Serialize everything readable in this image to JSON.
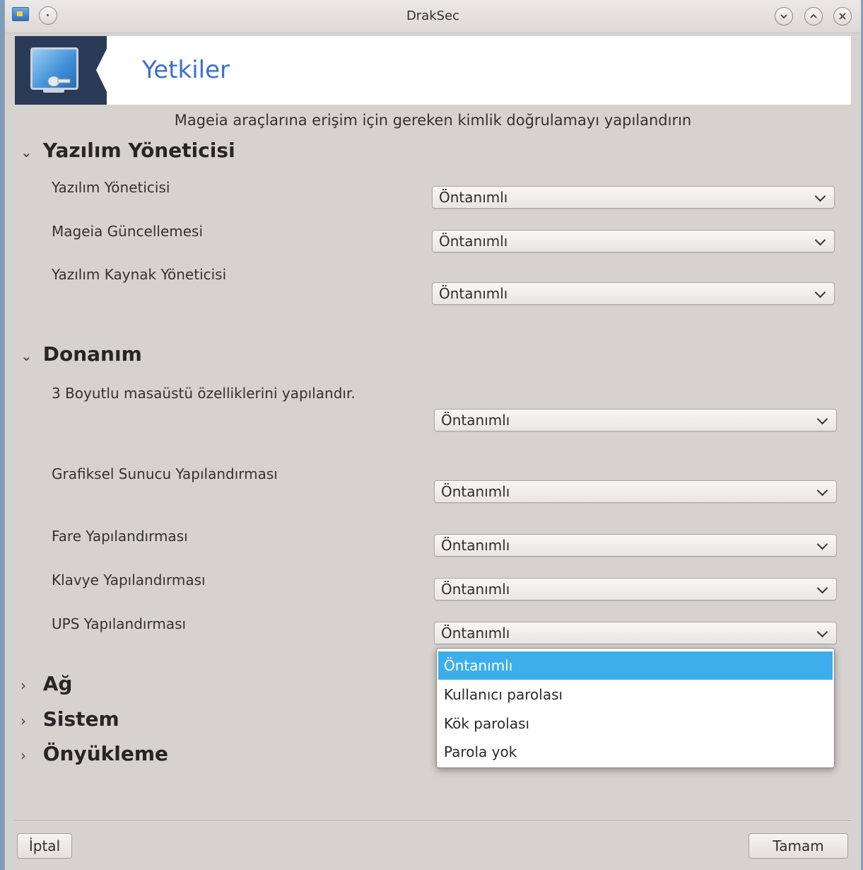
{
  "window": {
    "title": "DrakSec"
  },
  "header": {
    "title": "Yetkiler"
  },
  "subtitle": "Mageia araçlarına erişim için gereken kimlik doğrulamayı yapılandırın",
  "sections": {
    "software": {
      "title": "Yazılım Yöneticisi",
      "expanded": true
    },
    "hardware": {
      "title": "Donanım",
      "expanded": true
    },
    "network": {
      "title": "Ağ",
      "expanded": false
    },
    "system": {
      "title": "Sistem",
      "expanded": false
    },
    "boot": {
      "title": "Önyükleme",
      "expanded": false
    }
  },
  "software_rows": [
    {
      "label": "Yazılım Yöneticisi",
      "value": "Öntanımlı"
    },
    {
      "label": "Mageia Güncellemesi",
      "value": "Öntanımlı"
    },
    {
      "label": "Yazılım Kaynak Yöneticisi",
      "value": "Öntanımlı"
    }
  ],
  "hardware_rows": [
    {
      "label": "3 Boyutlu masaüstü özelliklerini yapılandır.",
      "value": "Öntanımlı"
    },
    {
      "label": "Grafiksel Sunucu Yapılandırması",
      "value": "Öntanımlı"
    },
    {
      "label": "Fare Yapılandırması",
      "value": "Öntanımlı"
    },
    {
      "label": "Klavye Yapılandırması",
      "value": "Öntanımlı"
    },
    {
      "label": "UPS Yapılandırması",
      "value": "Öntanımlı"
    }
  ],
  "dropdown_options": [
    "Öntanımlı",
    "Kullanıcı parolası",
    "Kök parolası",
    "Parola yok"
  ],
  "dropdown_selected_index": 0,
  "buttons": {
    "cancel": "İptal",
    "ok": "Tamam"
  },
  "colors": {
    "accent": "#3daee9",
    "title_blue": "#3b6fd1",
    "logo_bg": "#2b3b57"
  }
}
